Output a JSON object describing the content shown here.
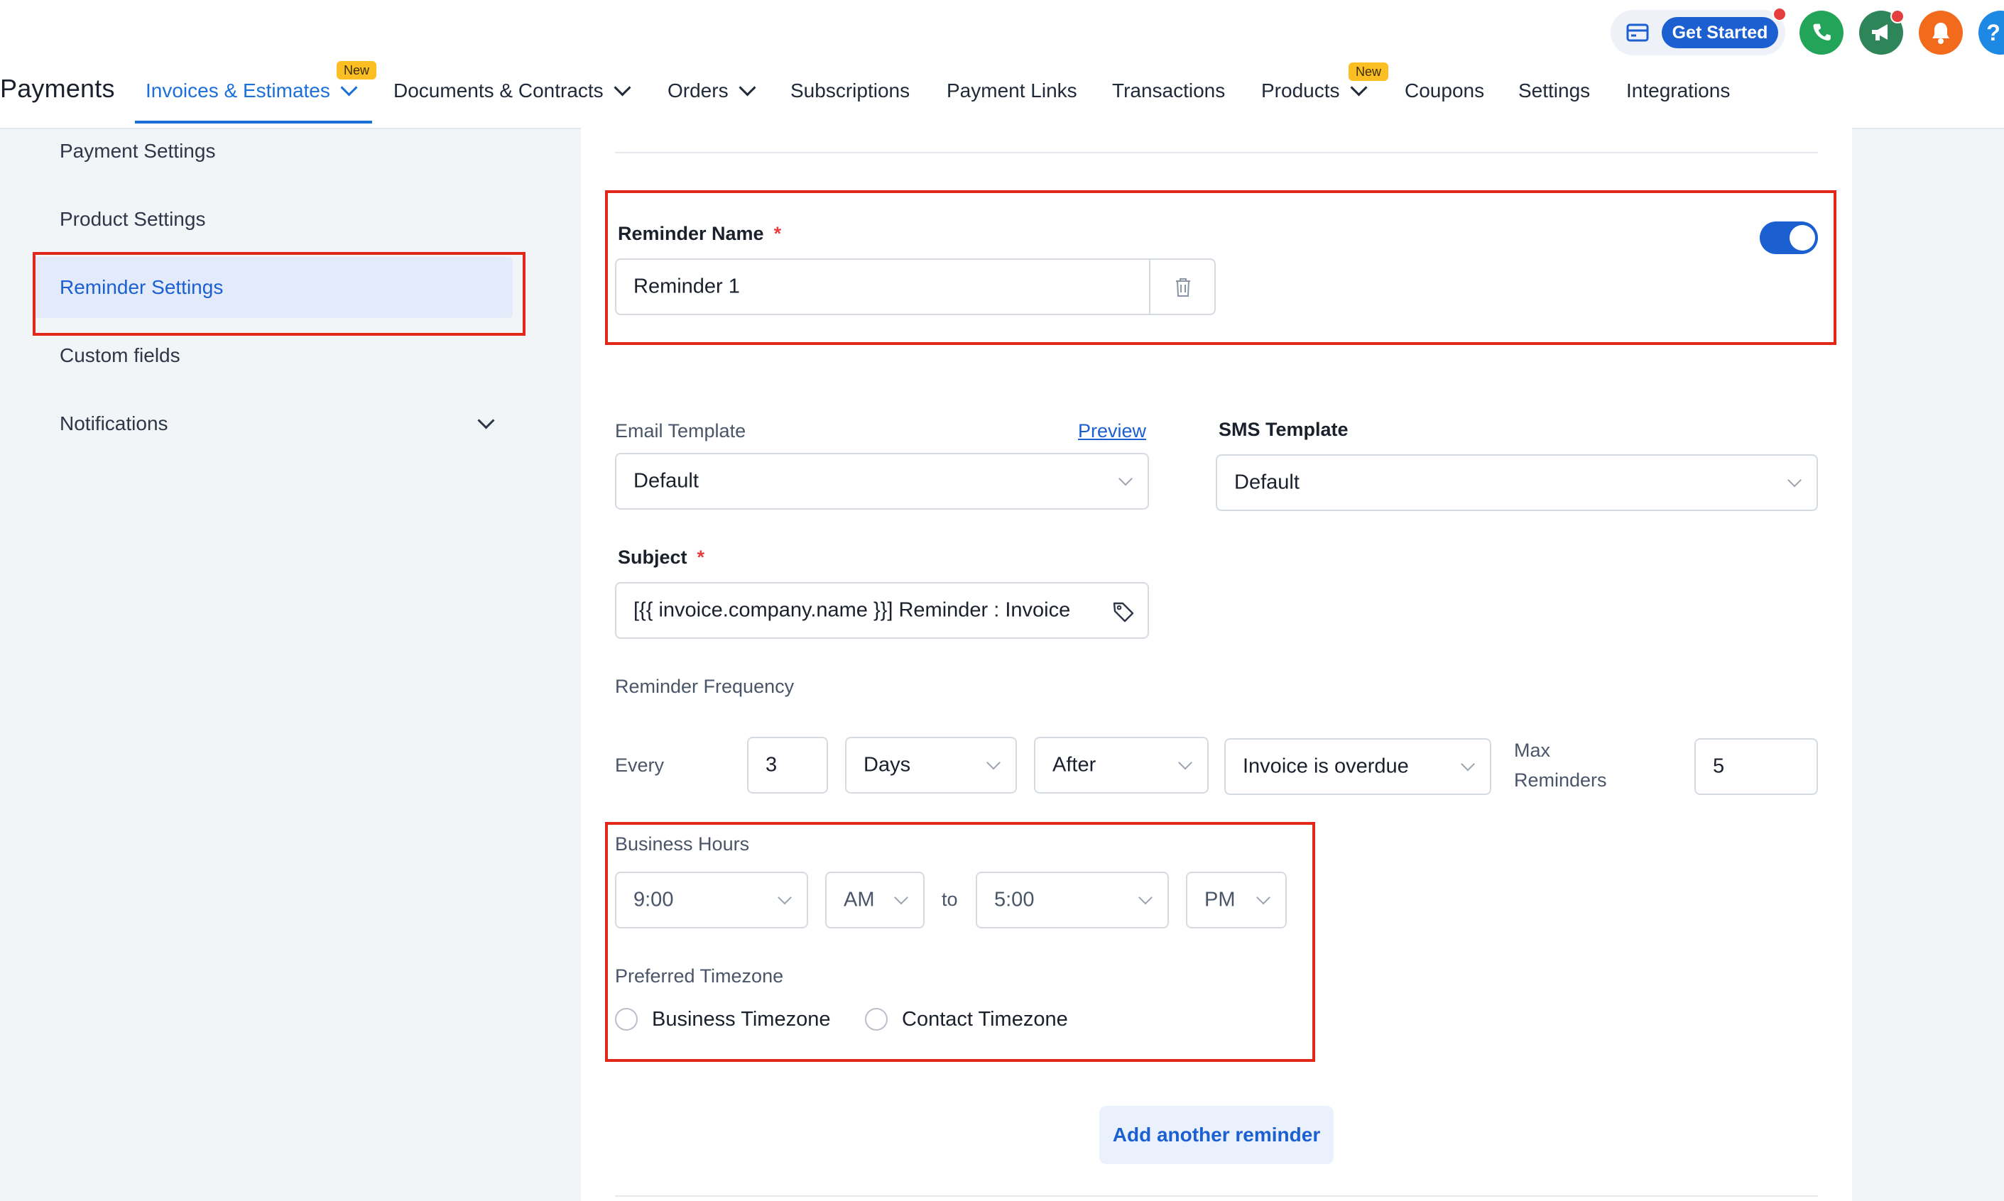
{
  "header": {
    "brand": "Payments",
    "nav": [
      {
        "label": "Invoices & Estimates",
        "badge": "New"
      },
      {
        "label": "Documents & Contracts"
      },
      {
        "label": "Orders"
      },
      {
        "label": "Subscriptions"
      },
      {
        "label": "Payment Links"
      },
      {
        "label": "Transactions"
      },
      {
        "label": "Products",
        "badge": "New"
      },
      {
        "label": "Coupons"
      },
      {
        "label": "Settings"
      },
      {
        "label": "Integrations"
      }
    ],
    "get_started_label": "Get Started",
    "icons": [
      "card-icon",
      "phone-icon",
      "megaphone-icon",
      "bell-icon",
      "help-icon"
    ],
    "help_label": "?"
  },
  "sidebar": {
    "items": [
      {
        "label": "Payment Settings"
      },
      {
        "label": "Product Settings"
      },
      {
        "label": "Reminder Settings",
        "active": true
      },
      {
        "label": "Custom fields"
      },
      {
        "label": "Notifications"
      }
    ]
  },
  "reminder": {
    "name_label": "Reminder Name",
    "required_mark": "*",
    "name_value": "Reminder 1",
    "enabled": true,
    "email_template_label": "Email Template",
    "preview_label": "Preview",
    "email_template_value": "Default",
    "sms_template_label": "SMS Template",
    "sms_template_value": "Default",
    "subject_label": "Subject",
    "subject_value": "[{{ invoice.company.name }}] Reminder : Invoice",
    "frequency_label": "Reminder Frequency",
    "every_label": "Every",
    "every_value": "3",
    "unit_value": "Days",
    "when_value": "After",
    "trigger_value": "Invoice is overdue",
    "max_label_1": "Max",
    "max_label_2": "Reminders",
    "max_value": "5",
    "business_hours_label": "Business Hours",
    "start_time": "9:00",
    "start_period": "AM",
    "to_label": "to",
    "end_time": "5:00",
    "end_period": "PM",
    "timezone_label": "Preferred Timezone",
    "timezone_options": [
      "Business Timezone",
      "Contact Timezone"
    ],
    "add_button_label": "Add another reminder"
  },
  "colors": {
    "accent": "#1b6fd9",
    "highlight_box": "#e0271a",
    "badge": "#fbbf24"
  }
}
